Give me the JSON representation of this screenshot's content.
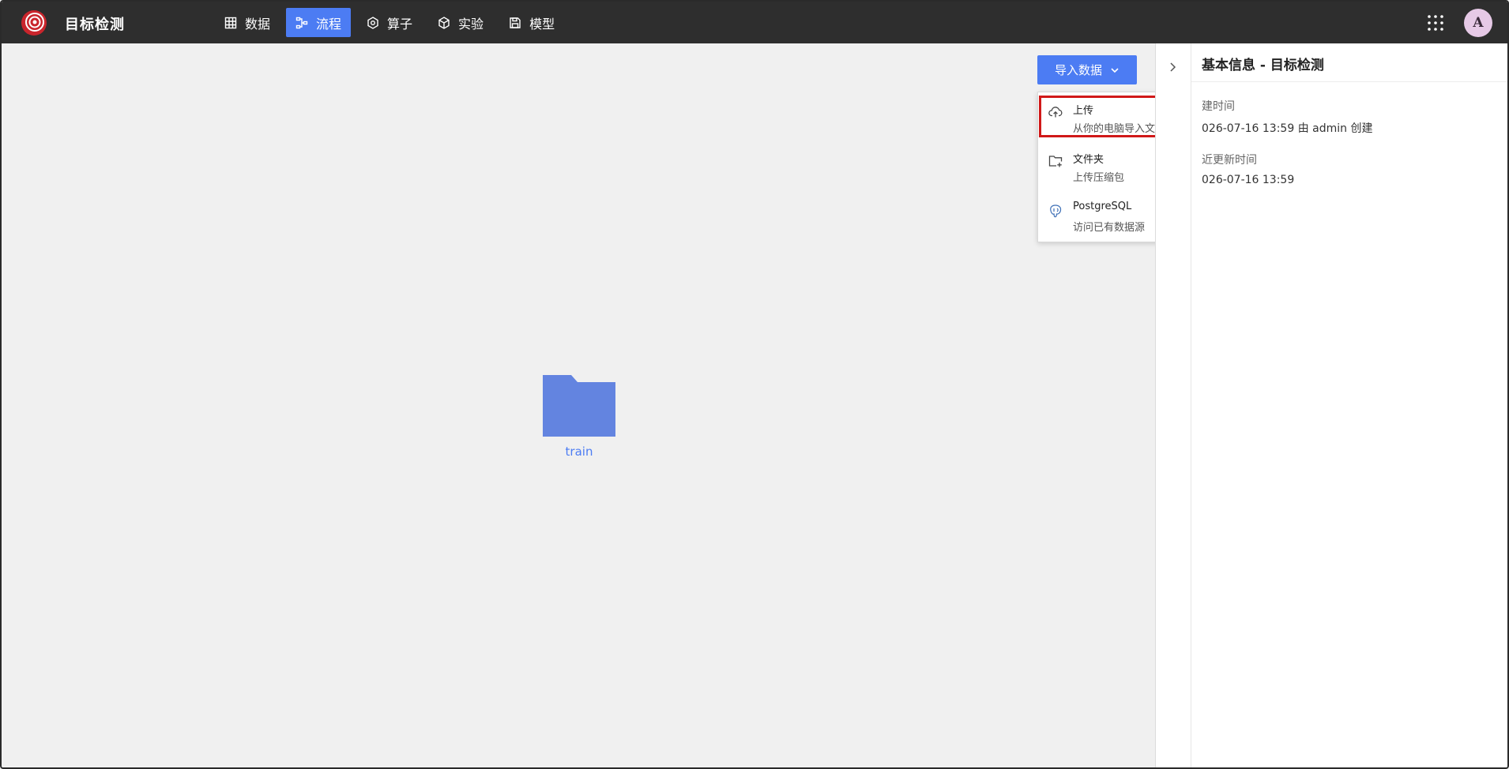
{
  "app": {
    "title": "目标检测"
  },
  "nav": [
    {
      "label": "数据",
      "icon": "table-icon",
      "active": false
    },
    {
      "label": "流程",
      "icon": "flow-icon",
      "active": true
    },
    {
      "label": "算子",
      "icon": "hexagon-icon",
      "active": false
    },
    {
      "label": "实验",
      "icon": "cube-icon",
      "active": false
    },
    {
      "label": "模型",
      "icon": "save-icon",
      "active": false
    }
  ],
  "user": {
    "avatar_initial": "A"
  },
  "import": {
    "button_label": "导入数据",
    "menu": [
      {
        "title": "上传",
        "subtitle": "从你的电脑导入文件",
        "icon": "cloud-upload-icon"
      },
      {
        "title": "文件夹",
        "subtitle": "上传压缩包",
        "icon": "folder-add-icon"
      },
      {
        "title": "PostgreSQL",
        "subtitle": "访问已有数据源",
        "icon": "postgresql-icon"
      }
    ]
  },
  "canvas": {
    "folder_name": "train"
  },
  "info": {
    "title": "基本信息 - 目标检测",
    "created_label": "建时间",
    "created_value": "026-07-16 13:59  由 admin 创建",
    "updated_label": "近更新时间",
    "updated_value": "026-07-16 13:59"
  },
  "colors": {
    "accent": "#4c7cf3",
    "topbar": "#2e2e2e",
    "highlight": "#d01818"
  }
}
